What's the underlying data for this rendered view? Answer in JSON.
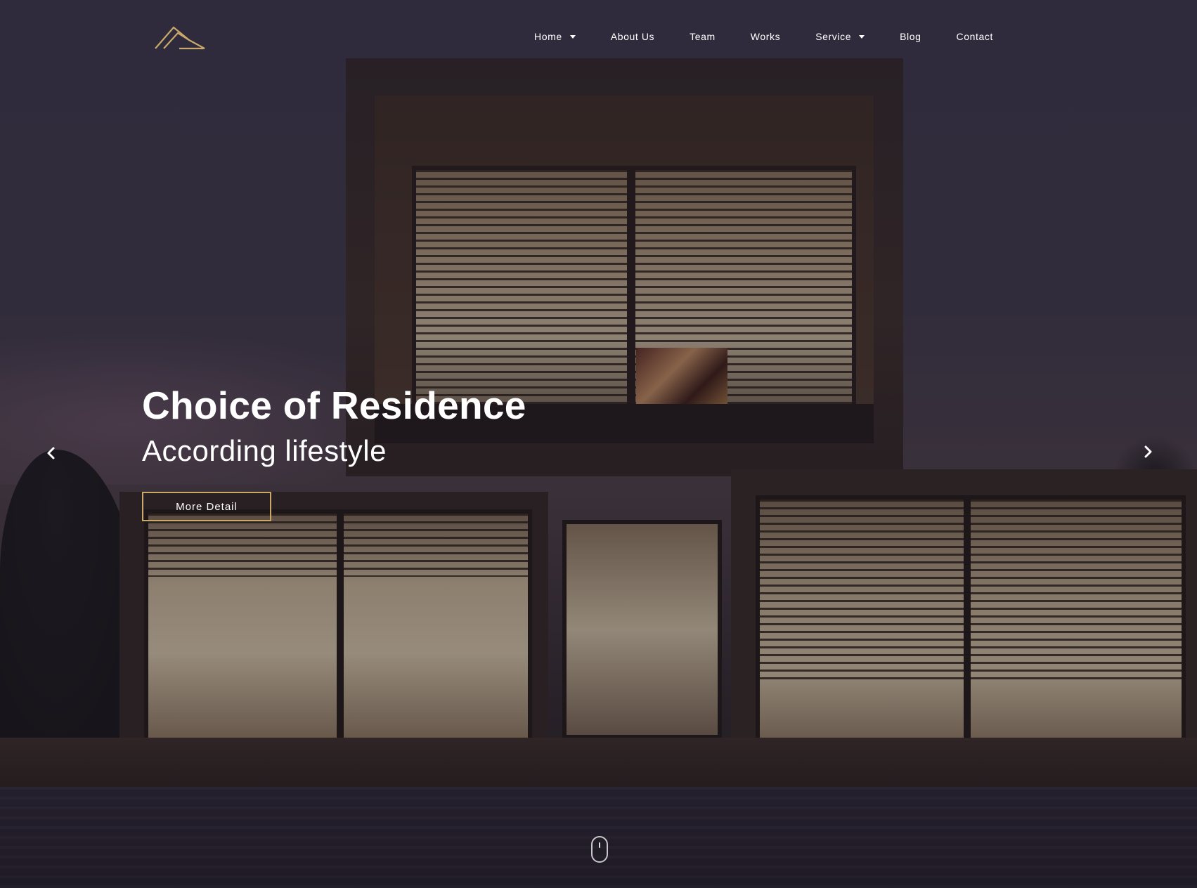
{
  "brand": {
    "logo_icon": "mountain-roof-logo-icon",
    "logo_color": "#c8a96a"
  },
  "nav": {
    "items": [
      {
        "label": "Home",
        "dropdown": true
      },
      {
        "label": "About Us",
        "dropdown": false
      },
      {
        "label": "Team",
        "dropdown": false
      },
      {
        "label": "Works",
        "dropdown": false
      },
      {
        "label": "Service",
        "dropdown": true
      },
      {
        "label": "Blog",
        "dropdown": false
      },
      {
        "label": "Contact",
        "dropdown": false
      }
    ]
  },
  "hero": {
    "title": "Choice of Residence",
    "subtitle": "According lifestyle",
    "button_label": "More Detail",
    "button_border_color": "#c8a96a"
  },
  "carousel": {
    "prev_icon": "chevron-left-icon",
    "next_icon": "chevron-right-icon"
  },
  "scroll_indicator": {
    "icon": "mouse-scroll-icon"
  }
}
